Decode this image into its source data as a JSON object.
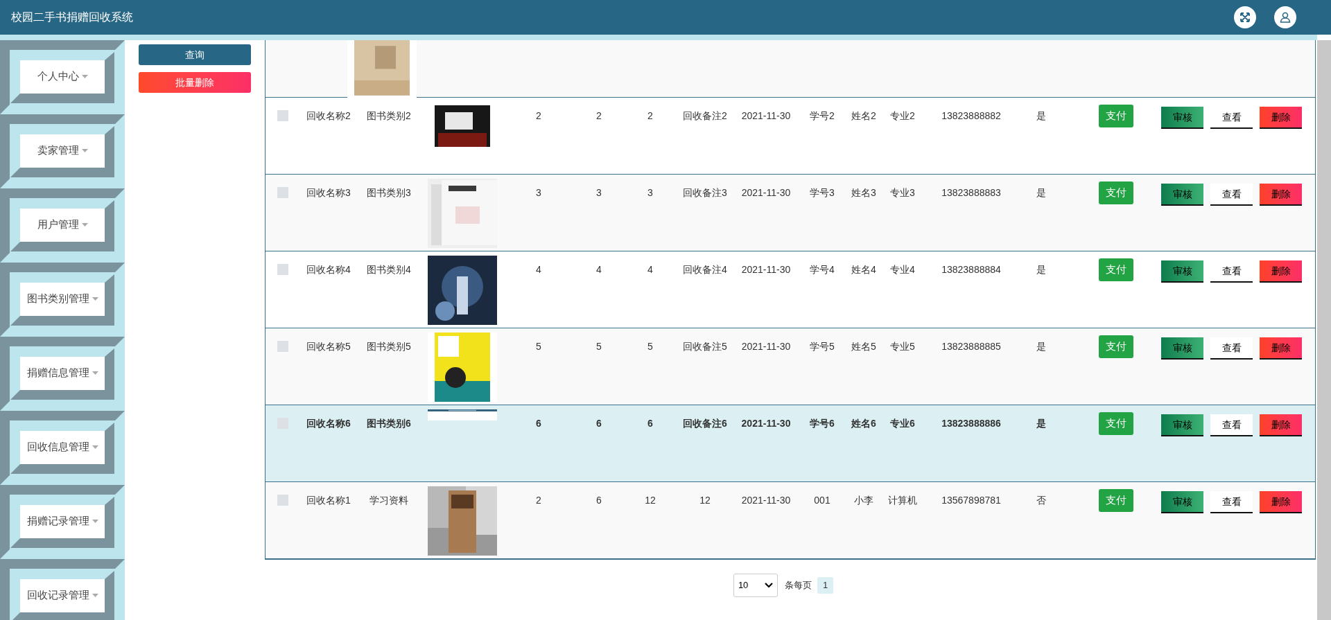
{
  "header": {
    "title": "校园二手书捐赠回收系统"
  },
  "sidebar": {
    "items": [
      {
        "label": "个人中心",
        "expanded": false
      },
      {
        "label": "卖家管理",
        "expanded": false
      },
      {
        "label": "用户管理",
        "expanded": false
      },
      {
        "label": "图书类别管理",
        "expanded": false
      },
      {
        "label": "捐赠信息管理",
        "expanded": false
      },
      {
        "label": "回收信息管理",
        "expanded": false
      },
      {
        "label": "捐赠记录管理",
        "expanded": false
      },
      {
        "label": "回收记录管理",
        "expanded": false
      }
    ]
  },
  "actions": {
    "search": "查询",
    "batch_delete": "批量删除"
  },
  "table": {
    "rows": [
      {
        "kind": "cut"
      },
      {
        "kind": "full",
        "checked": false,
        "highlighted": false,
        "cells": [
          "回收名称2",
          "图书类别2",
          "2",
          "2",
          "2",
          "回收备注2",
          "2021-11-30",
          "学号2",
          "姓名2",
          "专业2",
          "13823888882",
          "是"
        ],
        "buttons": [
          "支付",
          "审核",
          "查看",
          "删除"
        ]
      },
      {
        "kind": "full",
        "checked": false,
        "highlighted": false,
        "cells": [
          "回收名称3",
          "图书类别3",
          "3",
          "3",
          "3",
          "回收备注3",
          "2021-11-30",
          "学号3",
          "姓名3",
          "专业3",
          "13823888883",
          "是"
        ],
        "buttons": [
          "支付",
          "审核",
          "查看",
          "删除"
        ]
      },
      {
        "kind": "full",
        "checked": false,
        "highlighted": false,
        "cells": [
          "回收名称4",
          "图书类别4",
          "4",
          "4",
          "4",
          "回收备注4",
          "2021-11-30",
          "学号4",
          "姓名4",
          "专业4",
          "13823888884",
          "是"
        ],
        "buttons": [
          "支付",
          "审核",
          "查看",
          "删除"
        ]
      },
      {
        "kind": "full",
        "checked": false,
        "highlighted": false,
        "cells": [
          "回收名称5",
          "图书类别5",
          "5",
          "5",
          "5",
          "回收备注5",
          "2021-11-30",
          "学号5",
          "姓名5",
          "专业5",
          "13823888885",
          "是"
        ],
        "buttons": [
          "支付",
          "审核",
          "查看",
          "删除"
        ]
      },
      {
        "kind": "full",
        "checked": false,
        "highlighted": true,
        "cells": [
          "回收名称6",
          "图书类别6",
          "6",
          "6",
          "6",
          "回收备注6",
          "2021-11-30",
          "学号6",
          "姓名6",
          "专业6",
          "13823888886",
          "是"
        ],
        "buttons": [
          "支付",
          "审核",
          "查看",
          "删除"
        ]
      },
      {
        "kind": "full",
        "checked": false,
        "highlighted": false,
        "cells": [
          "回收名称1",
          "学习资料",
          "2",
          "6",
          "12",
          "12",
          "2021-11-30",
          "001",
          "小李",
          "计算机",
          "13567898781",
          "否"
        ],
        "buttons": [
          "支付",
          "审核",
          "查看",
          "删除"
        ]
      }
    ]
  },
  "pagination": {
    "page_size": "10",
    "page_size_label": "条每页",
    "pages": [
      {
        "label": "1",
        "selected": true
      }
    ]
  }
}
